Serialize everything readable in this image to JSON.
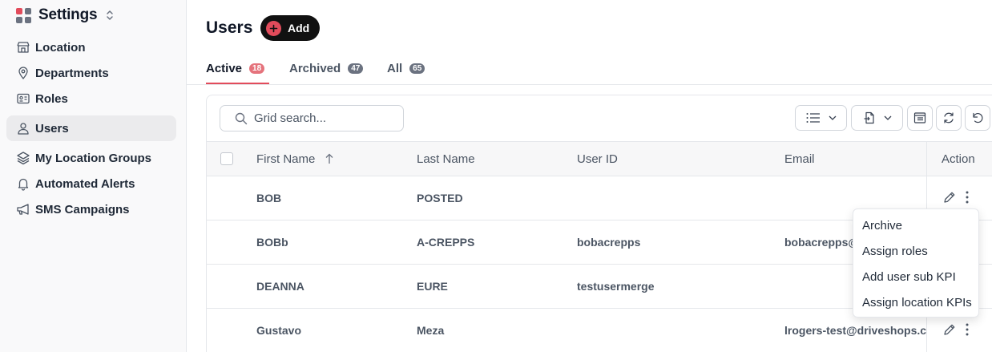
{
  "colors": {
    "accent": "#e24b5b",
    "logo": [
      "#e24b5b",
      "#6b7280",
      "#6b7280",
      "#6b7280"
    ]
  },
  "app": {
    "title": "Settings",
    "switcher_icon": "chevron-up-down-icon"
  },
  "sidebar": {
    "items": [
      {
        "label": "Location",
        "icon": "store-icon",
        "active": false
      },
      {
        "label": "Departments",
        "icon": "map-pin-icon",
        "active": false
      },
      {
        "label": "Roles",
        "icon": "id-card-icon",
        "active": false
      },
      {
        "label": "Users",
        "icon": "user-icon",
        "active": true
      },
      {
        "label": "My Location Groups",
        "icon": "layers-icon",
        "active": false
      },
      {
        "label": "Automated Alerts",
        "icon": "bell-icon",
        "active": false
      },
      {
        "label": "SMS Campaigns",
        "icon": "megaphone-icon",
        "active": false
      }
    ]
  },
  "main": {
    "title": "Users",
    "add_label": "Add",
    "tabs": [
      {
        "label": "Active",
        "count": "18",
        "active": true
      },
      {
        "label": "Archived",
        "count": "47",
        "active": false
      },
      {
        "label": "All",
        "count": "65",
        "active": false
      }
    ]
  },
  "grid": {
    "search": {
      "placeholder": "Grid search...",
      "value": ""
    },
    "toolbar_icons": [
      "list-view-icon",
      "export-icon",
      "columns-icon",
      "refresh-icon",
      "reset-icon"
    ],
    "columns": {
      "first_name": "First Name",
      "last_name": "Last Name",
      "user_id": "User ID",
      "email": "Email",
      "action": "Action"
    },
    "sort": {
      "column": "First Name",
      "direction": "ascending"
    },
    "rows": [
      {
        "first_name": "BOB",
        "last_name": "POSTED",
        "user_id": "",
        "email": ""
      },
      {
        "first_name": "BOBb",
        "last_name": "A-CREPPS",
        "user_id": "bobacrepps",
        "email": "bobacrepps@"
      },
      {
        "first_name": "DEANNA",
        "last_name": "EURE",
        "user_id": "testusermerge",
        "email": ""
      },
      {
        "first_name": "Gustavo",
        "last_name": "Meza",
        "user_id": "",
        "email": "lrogers-test@driveshops.c"
      }
    ]
  },
  "row_menu": {
    "items": [
      "Archive",
      "Assign roles",
      "Add user sub KPI",
      "Assign location KPIs"
    ]
  }
}
